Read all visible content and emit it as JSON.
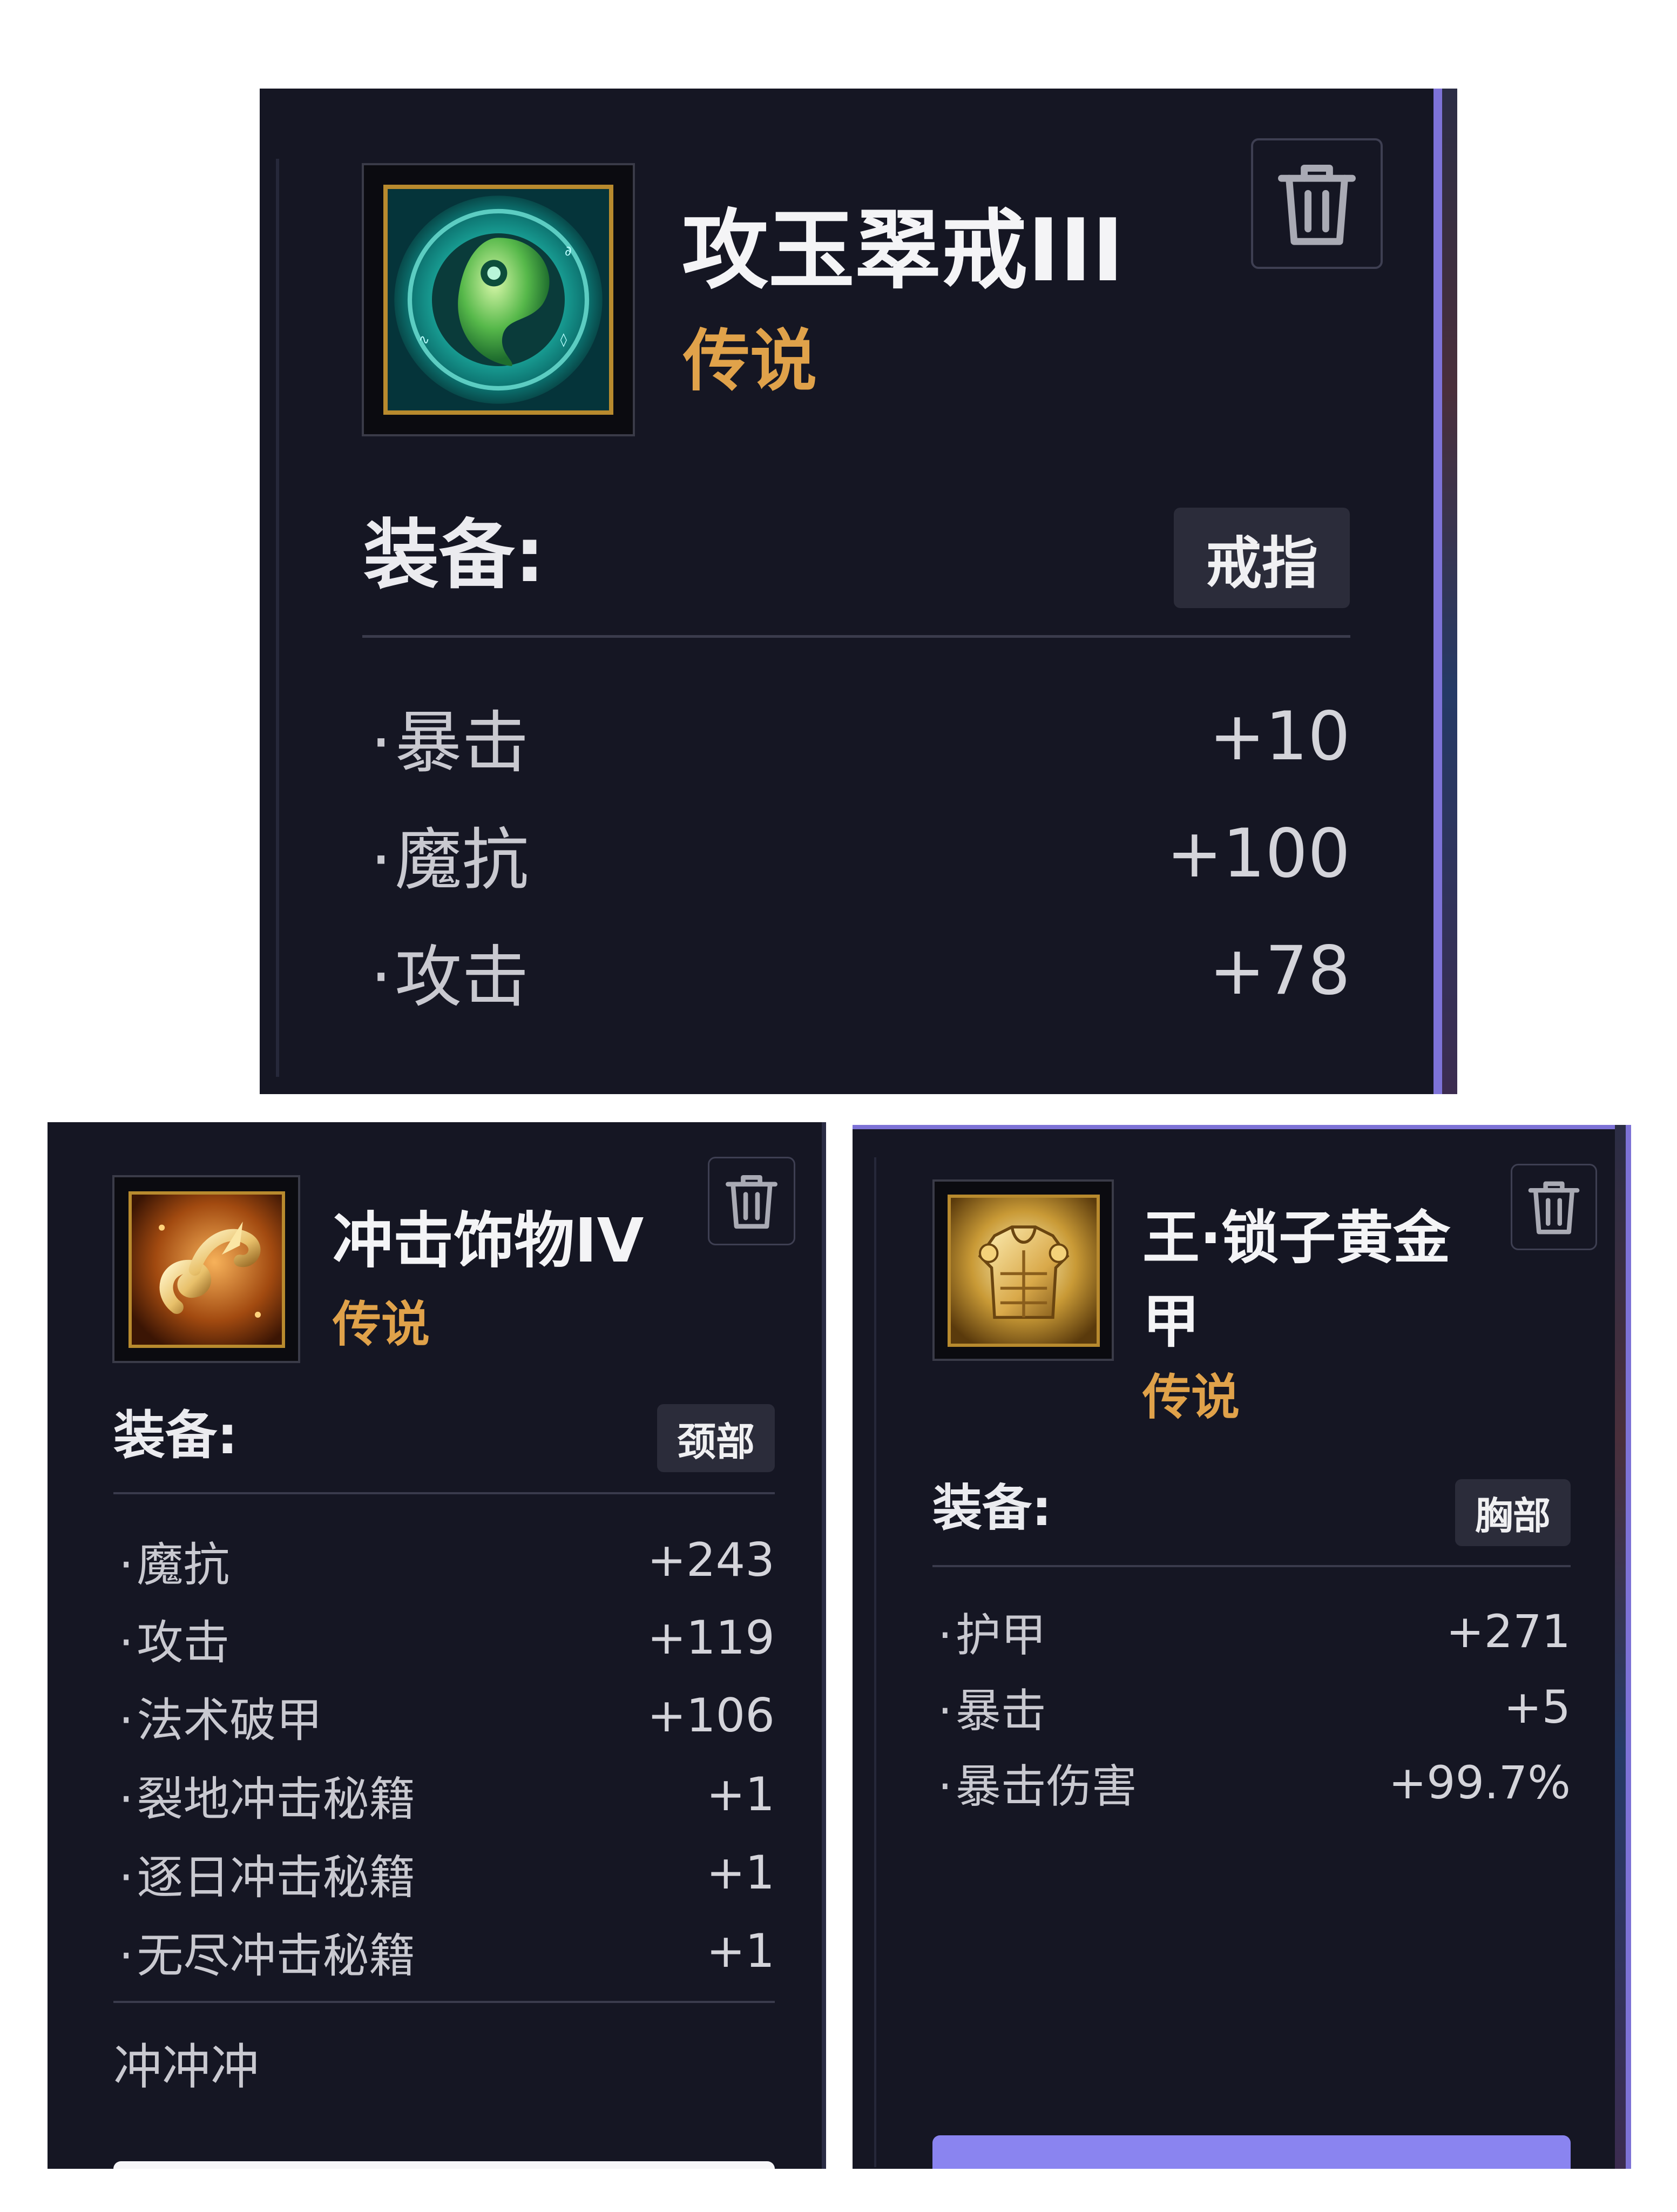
{
  "cards": {
    "ring": {
      "name": "攻玉翠戒III",
      "rarity": "传说",
      "equip_label": "装备:",
      "slot": "戒指",
      "stats": [
        {
          "name": "暴击",
          "value": "+10"
        },
        {
          "name": "魔抗",
          "value": "+100"
        },
        {
          "name": "攻击",
          "value": "+78"
        }
      ]
    },
    "neck": {
      "name": "冲击饰物IV",
      "rarity": "传说",
      "equip_label": "装备:",
      "slot": "颈部",
      "stats": [
        {
          "name": "魔抗",
          "value": "+243"
        },
        {
          "name": "攻击",
          "value": "+119"
        },
        {
          "name": "法术破甲",
          "value": "+106"
        },
        {
          "name": "裂地冲击秘籍",
          "value": "+1"
        },
        {
          "name": "逐日冲击秘籍",
          "value": "+1"
        },
        {
          "name": "无尽冲击秘籍",
          "value": "+1"
        }
      ],
      "note": "冲冲冲"
    },
    "chest": {
      "name_line1": "王·锁子黄金",
      "name_line2": "甲",
      "rarity": "传说",
      "equip_label": "装备:",
      "slot": "胸部",
      "stats": [
        {
          "name": "护甲",
          "value": "+271"
        },
        {
          "name": "暴击",
          "value": "+5"
        },
        {
          "name": "暴击伤害",
          "value": "+99.7%"
        }
      ]
    }
  },
  "icons": {
    "ring_icon": "jade-ring-icon",
    "neck_icon": "golden-charm-icon",
    "chest_icon": "golden-armor-icon",
    "delete": "trash-icon"
  },
  "colors": {
    "card_bg": "#151623",
    "rarity_legendary": "#e0a24a",
    "accent": "#8a84f0",
    "icon_border": "#b88a2e"
  }
}
